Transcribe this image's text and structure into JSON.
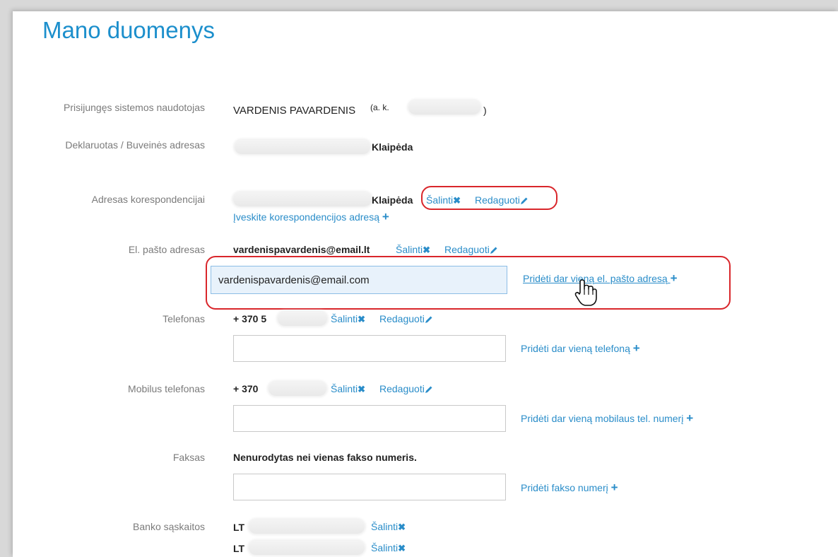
{
  "page": {
    "title": "Mano duomenys"
  },
  "user": {
    "label": "Prisijungęs sistemos naudotojas",
    "name": "VARDENIS PAVARDENIS",
    "code_prefix": "(a. k.",
    "code_suffix": ")"
  },
  "declared": {
    "label": "Deklaruotas / Buveinės adresas",
    "city": "Klaipėda"
  },
  "correspondence": {
    "label": "Adresas korespondencijai",
    "city": "Klaipėda",
    "remove_label": "Šalinti",
    "edit_label": "Redaguoti",
    "add_label": "Įveskite korespondencijos adresą"
  },
  "email": {
    "label": "El. pašto adresas",
    "value": "vardenispavardenis@email.lt",
    "remove_label": "Šalinti",
    "edit_label": "Redaguoti",
    "input_value": "vardenispavardenis@email.com",
    "add_label": "Pridėti dar vieną el. pašto adresą"
  },
  "phone": {
    "label": "Telefonas",
    "value": "+ 370 5",
    "remove_label": "Šalinti",
    "edit_label": "Redaguoti",
    "input_value": "",
    "add_label": "Pridėti dar vieną telefoną"
  },
  "mobile": {
    "label": "Mobilus telefonas",
    "value": "+ 370",
    "remove_label": "Šalinti",
    "edit_label": "Redaguoti",
    "input_value": "",
    "add_label": "Pridėti dar vieną mobilaus tel. numerį"
  },
  "fax": {
    "label": "Faksas",
    "value": "Nenurodytas nei vienas fakso numeris.",
    "input_value": "",
    "add_label": "Pridėti fakso numerį"
  },
  "bank": {
    "label": "Banko sąskaitos",
    "accounts": [
      {
        "prefix": "LT",
        "remove_label": "Šalinti"
      },
      {
        "prefix": "LT",
        "remove_label": "Šalinti"
      }
    ]
  },
  "colors": {
    "accent": "#2a8dc9",
    "title": "#1c8fcc",
    "highlight": "#d9262b"
  },
  "icons": {
    "remove": "close-icon",
    "edit": "pencil-icon",
    "add": "plus-icon",
    "cursor": "hand-pointer-icon"
  }
}
